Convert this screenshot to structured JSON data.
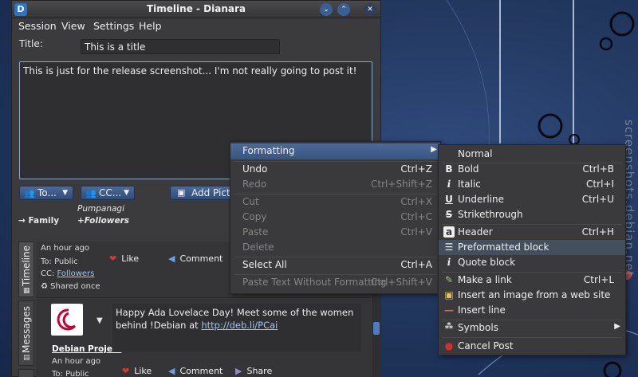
{
  "desktop": {
    "watermark": "screenshots.debian.net"
  },
  "window": {
    "title": "Timeline - Dianara",
    "app_icon": "D",
    "buttons": {
      "minimize": "⌄",
      "maximize": "⌃",
      "close": "✕"
    }
  },
  "menubar": [
    "Session",
    "View",
    "Settings",
    "Help"
  ],
  "composer": {
    "title_label": "Title:",
    "title_value": "This is a title",
    "body_text": "This is just for the release screenshot... I'm not really going to post it!",
    "to_button": "To...",
    "cc_button": "CC...",
    "add_picture": "Add Picture",
    "to_summary": "→ Family",
    "cc_name": "Pumpanagi",
    "cc_summary": "+Followers"
  },
  "tabs": {
    "timeline": "Timeline",
    "messages": "Messages"
  },
  "posts": [
    {
      "time": "An hour ago",
      "to": "To: Public",
      "cc_label": "CC:",
      "cc_link": "Followers",
      "shared": "♻ Shared once",
      "like": "Like",
      "comment": "Comment"
    },
    {
      "author": "Debian Project",
      "time": "An hour ago",
      "to": "To: Public",
      "text": "Happy Ada Lovelace Day! Meet some of the women behind !Debian at ",
      "link": "http://deb.li/PCai",
      "like": "Like",
      "comment": "Comment",
      "share": "Share"
    }
  ],
  "context_menu": [
    {
      "label": "Formatting",
      "submenu": true,
      "active": true
    },
    {
      "label": "Undo",
      "shortcut": "Ctrl+Z"
    },
    {
      "label": "Redo",
      "shortcut": "Ctrl+Shift+Z",
      "disabled": true
    },
    {
      "label": "Cut",
      "shortcut": "Ctrl+X",
      "disabled": true
    },
    {
      "label": "Copy",
      "shortcut": "Ctrl+C",
      "disabled": true
    },
    {
      "label": "Paste",
      "shortcut": "Ctrl+V",
      "disabled": true
    },
    {
      "label": "Delete",
      "disabled": true
    },
    {
      "label": "Select All",
      "shortcut": "Ctrl+A"
    },
    {
      "label": "Paste Text Without Formatting",
      "shortcut": "Ctrl+Shift+V",
      "disabled": true
    }
  ],
  "formatting_menu": [
    {
      "label": "Normal",
      "icon": ""
    },
    {
      "label": "Bold",
      "icon": "B",
      "shortcut": "Ctrl+B"
    },
    {
      "label": "Italic",
      "icon": "i",
      "shortcut": "Ctrl+I"
    },
    {
      "label": "Underline",
      "icon": "U",
      "shortcut": "Ctrl+U"
    },
    {
      "label": "Strikethrough",
      "icon": "S"
    },
    {
      "label": "Header",
      "icon": "a",
      "shortcut": "Ctrl+H"
    },
    {
      "label": "Preformatted block",
      "icon": "☰",
      "active": true
    },
    {
      "label": "Quote block",
      "icon": "i"
    },
    {
      "label": "Make a link",
      "icon": "✎",
      "shortcut": "Ctrl+L"
    },
    {
      "label": "Insert an image from a web site",
      "icon": "▣"
    },
    {
      "label": "Insert line",
      "icon": "—"
    },
    {
      "label": "Symbols",
      "icon": "⁂",
      "submenu": true
    },
    {
      "label": "Cancel Post",
      "icon": "●"
    }
  ]
}
